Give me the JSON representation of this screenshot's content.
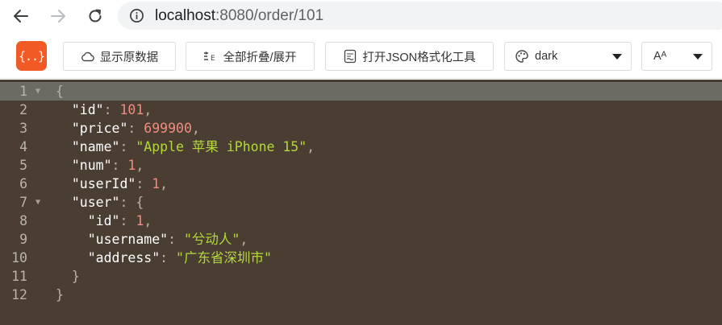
{
  "browser": {
    "url_host": "localhost",
    "url_path": ":8080/order/101"
  },
  "toolbar": {
    "logo_text": "{..}",
    "show_raw_label": "显示原数据",
    "fold_all_label": "全部折叠/展开",
    "open_tool_label": "打开JSON格式化工具",
    "theme_value": "dark",
    "font_value": "Aᴬ"
  },
  "editor": {
    "line_numbers": [
      "1",
      "2",
      "3",
      "4",
      "5",
      "6",
      "7",
      "8",
      "9",
      "10",
      "11",
      "12"
    ],
    "lines": [
      {
        "ind": "",
        "k": "",
        "s": "",
        "n": "",
        "p": "{"
      },
      {
        "ind": "  ",
        "k": "\"id\"",
        "s": "",
        "n": "101",
        "p": ","
      },
      {
        "ind": "  ",
        "k": "\"price\"",
        "s": "",
        "n": "699900",
        "p": ","
      },
      {
        "ind": "  ",
        "k": "\"name\"",
        "s": "\"Apple 苹果 iPhone 15\"",
        "n": "",
        "p": ","
      },
      {
        "ind": "  ",
        "k": "\"num\"",
        "s": "",
        "n": "1",
        "p": ","
      },
      {
        "ind": "  ",
        "k": "\"userId\"",
        "s": "",
        "n": "1",
        "p": ","
      },
      {
        "ind": "  ",
        "k": "\"user\"",
        "s": "",
        "n": "",
        "p": "{"
      },
      {
        "ind": "    ",
        "k": "\"id\"",
        "s": "",
        "n": "1",
        "p": ","
      },
      {
        "ind": "    ",
        "k": "\"username\"",
        "s": "\"兮动人\"",
        "n": "",
        "p": ","
      },
      {
        "ind": "    ",
        "k": "\"address\"",
        "s": "\"广东省深圳市\"",
        "n": "",
        "p": ""
      },
      {
        "ind": "  ",
        "k": "",
        "s": "",
        "n": "",
        "p": "}"
      },
      {
        "ind": "",
        "k": "",
        "s": "",
        "n": "",
        "p": "}"
      }
    ]
  },
  "colors": {
    "editor_bg": "#4a3d31",
    "active_line": "#6b6b63",
    "key": "#ffffff",
    "number": "#f08c84",
    "string": "#b4d83a",
    "logo_bg": "#f15a24"
  }
}
